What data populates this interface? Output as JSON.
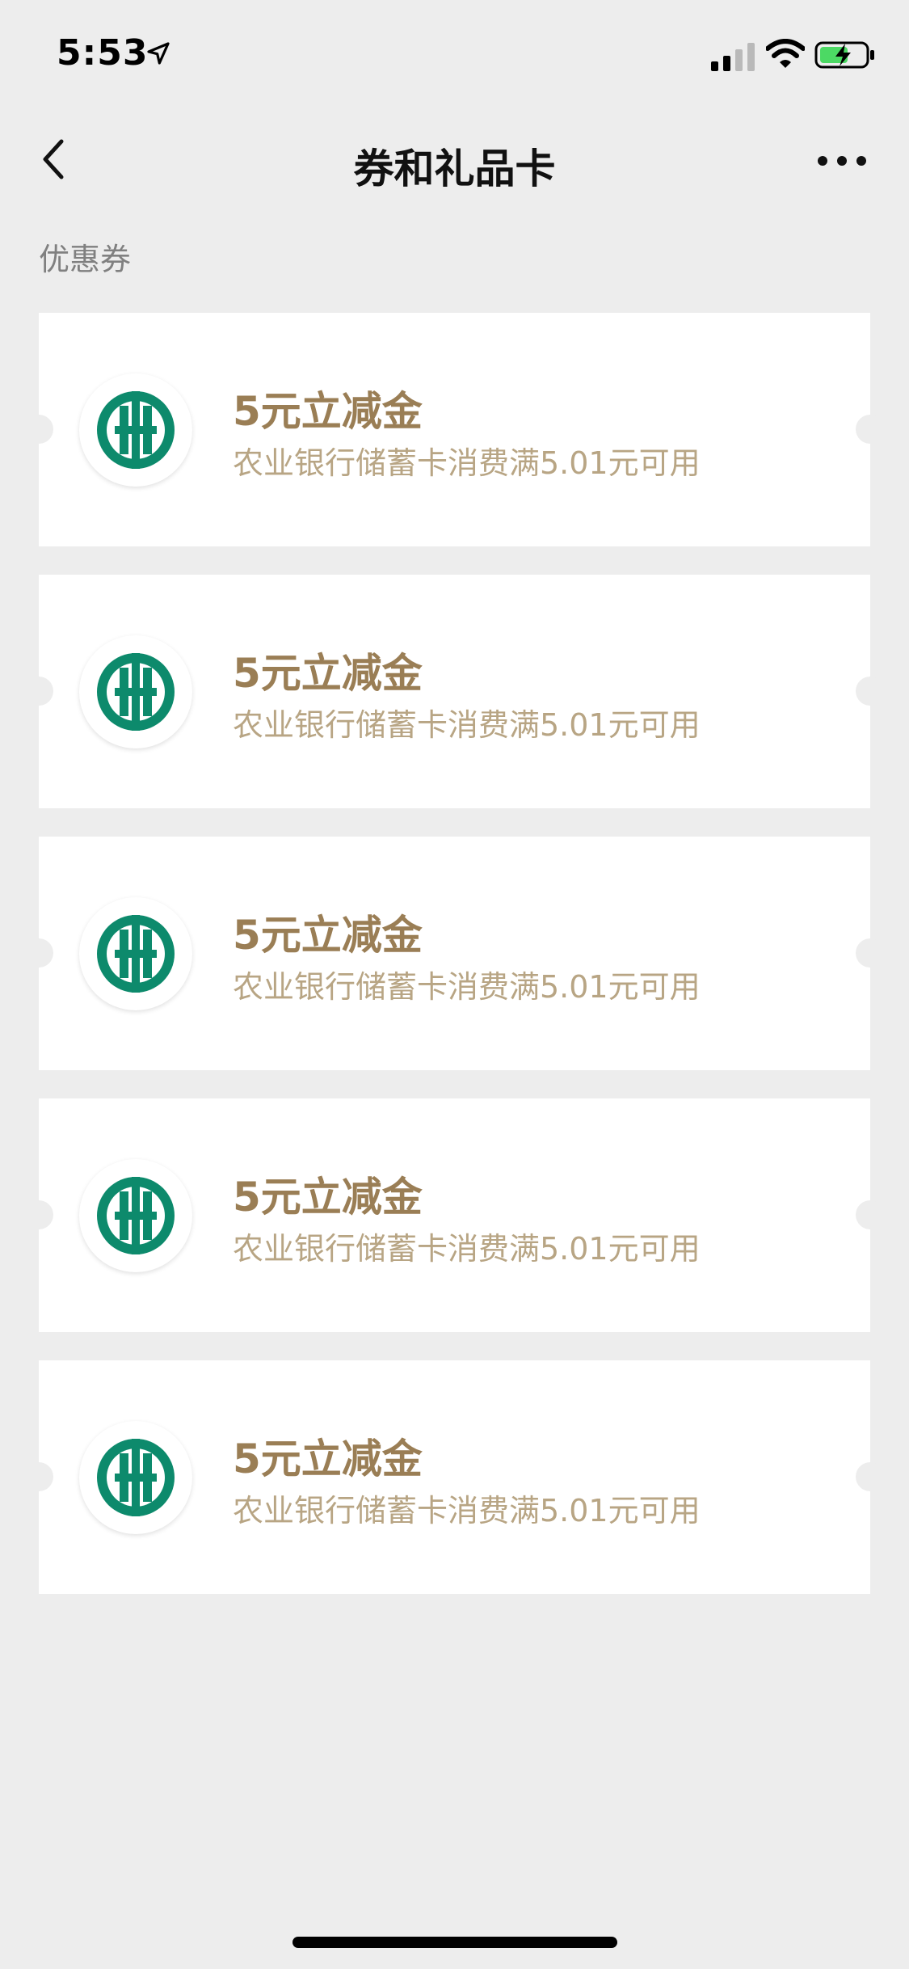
{
  "status": {
    "time": "5:53"
  },
  "nav": {
    "title": "券和礼品卡"
  },
  "section": {
    "label": "优惠券"
  },
  "coupons": [
    {
      "title": "5元立减金",
      "desc": "农业银行储蓄卡消费满5.01元可用"
    },
    {
      "title": "5元立减金",
      "desc": "农业银行储蓄卡消费满5.01元可用"
    },
    {
      "title": "5元立减金",
      "desc": "农业银行储蓄卡消费满5.01元可用"
    },
    {
      "title": "5元立减金",
      "desc": "农业银行储蓄卡消费满5.01元可用"
    },
    {
      "title": "5元立减金",
      "desc": "农业银行储蓄卡消费满5.01元可用"
    }
  ],
  "colors": {
    "bank_green": "#0d8a6c",
    "coupon_title": "#9a7e55",
    "coupon_desc": "#b8a584",
    "background": "#ededed"
  }
}
